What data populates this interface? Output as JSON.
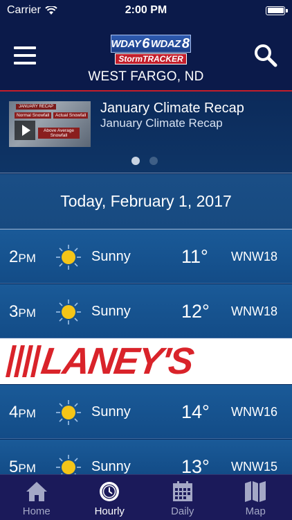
{
  "status_bar": {
    "carrier": "Carrier",
    "time": "2:00 PM"
  },
  "header": {
    "logo_left": "WDAY",
    "logo_num_left": "6",
    "logo_right": "WDAZ",
    "logo_num_right": "8",
    "logo_sub": "StormTRACKER",
    "location": "WEST FARGO, ND"
  },
  "video": {
    "title": "January Climate Recap",
    "subtitle": "January Climate Recap",
    "thumbnail_text": [
      "JANUARY RECAP",
      "Normal Snowfall",
      "Actual Snowfall",
      "Above Average Snowfall"
    ],
    "active_page": 1,
    "page_count": 2
  },
  "date_label": "Today, February 1, 2017",
  "hours": [
    {
      "hour": "2",
      "ampm": "PM",
      "condition": "Sunny",
      "temp": "11°",
      "wind": "WNW18"
    },
    {
      "hour": "3",
      "ampm": "PM",
      "condition": "Sunny",
      "temp": "12°",
      "wind": "WNW18"
    },
    {
      "hour": "4",
      "ampm": "PM",
      "condition": "Sunny",
      "temp": "14°",
      "wind": "WNW16"
    },
    {
      "hour": "5",
      "ampm": "PM",
      "condition": "Sunny",
      "temp": "13°",
      "wind": "WNW15"
    }
  ],
  "ad": {
    "text": "LANEY'S"
  },
  "tabs": [
    {
      "label": "Home",
      "icon": "home-icon",
      "active": false
    },
    {
      "label": "Hourly",
      "icon": "clock-icon",
      "active": true
    },
    {
      "label": "Daily",
      "icon": "calendar-icon",
      "active": false
    },
    {
      "label": "Map",
      "icon": "map-icon",
      "active": false
    }
  ],
  "colors": {
    "header_bg": "#0b1a4a",
    "accent_red": "#c21e2b",
    "row_bg": "#1a5a98",
    "sun": "#f5c518",
    "tab_bg": "#1b1a5a"
  }
}
